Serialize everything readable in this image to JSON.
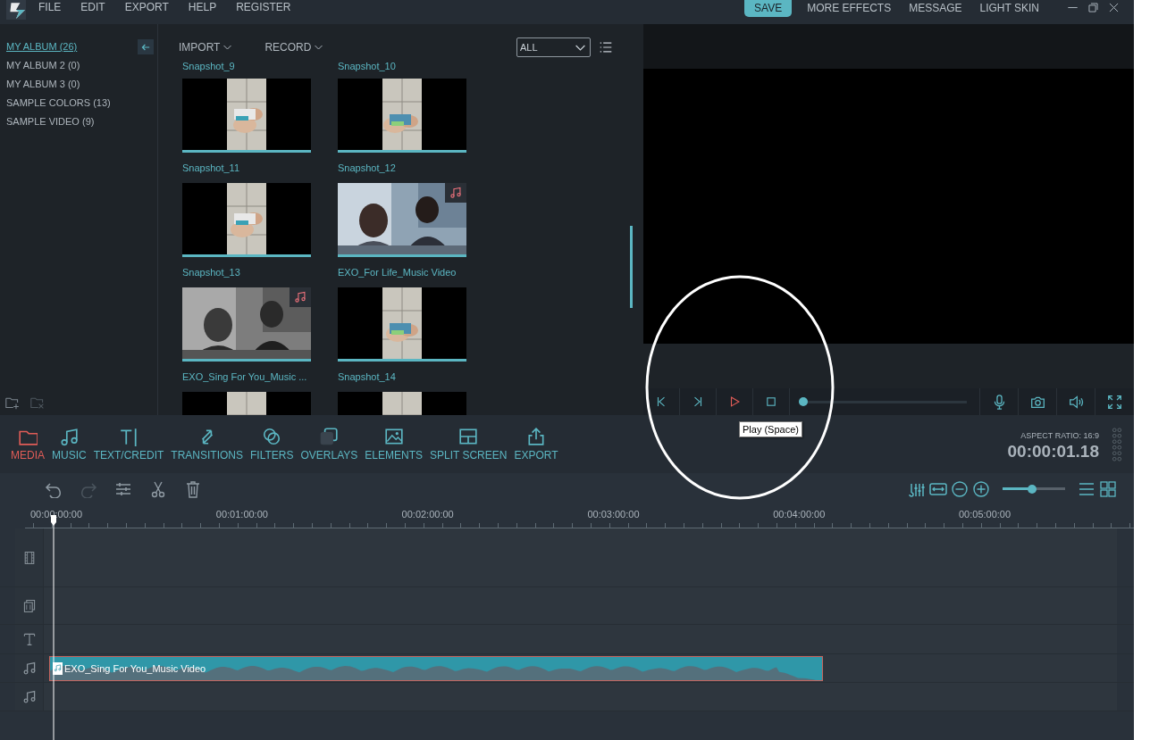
{
  "menu": [
    "FILE",
    "EDIT",
    "EXPORT",
    "HELP",
    "REGISTER"
  ],
  "top_actions": [
    {
      "label": "SAVE",
      "kind": "primary"
    },
    {
      "label": "MORE EFFECTS",
      "kind": "link"
    },
    {
      "label": "MESSAGE",
      "kind": "link"
    },
    {
      "label": "LIGHT SKIN",
      "kind": "link"
    }
  ],
  "albums": [
    {
      "label": "MY ALBUM (26)",
      "selected": true
    },
    {
      "label": "MY ALBUM 2 (0)",
      "selected": false
    },
    {
      "label": "MY ALBUM 3 (0)",
      "selected": false
    },
    {
      "label": "SAMPLE COLORS (13)",
      "selected": false
    },
    {
      "label": "SAMPLE VIDEO (9)",
      "selected": false
    }
  ],
  "media_toolbar": {
    "import": "IMPORT",
    "record": "RECORD",
    "filter": "ALL"
  },
  "media_items": [
    {
      "kind": "label_only",
      "label": "Snapshot_9"
    },
    {
      "kind": "label_only",
      "label": "Snapshot_10"
    },
    {
      "kind": "full",
      "label": "Snapshot_11",
      "music": false
    },
    {
      "kind": "full",
      "label": "Snapshot_12",
      "music": false
    },
    {
      "kind": "full",
      "label": "Snapshot_13",
      "music": false
    },
    {
      "kind": "full",
      "label": "EXO_For Life_Music Video",
      "music": true
    },
    {
      "kind": "full",
      "label": "EXO_Sing For You_Music ...",
      "music": true
    },
    {
      "kind": "full",
      "label": "Snapshot_14",
      "music": false
    },
    {
      "kind": "thumb_only",
      "music": false
    },
    {
      "kind": "thumb_only",
      "music": false
    }
  ],
  "preview": {
    "controls": [
      {
        "kind": "prev",
        "hovered": false
      },
      {
        "kind": "next",
        "hovered": false
      },
      {
        "kind": "play",
        "hovered": true
      },
      {
        "kind": "stop",
        "hovered": false
      }
    ],
    "progress": {
      "level": 0
    },
    "tooltip": "Play (Space)",
    "tools": [
      {
        "kind": "mic"
      },
      {
        "kind": "camera"
      },
      {
        "kind": "volume"
      },
      {
        "kind": "fullscreen"
      }
    ]
  },
  "tabs": [
    {
      "label": "MEDIA",
      "selected": true
    },
    {
      "label": "MUSIC",
      "selected": false
    },
    {
      "label": "TEXT/CREDIT",
      "selected": false
    },
    {
      "label": "TRANSITIONS",
      "selected": false
    },
    {
      "label": "FILTERS",
      "selected": false
    },
    {
      "label": "OVERLAYS",
      "selected": false
    },
    {
      "label": "ELEMENTS",
      "selected": false
    },
    {
      "label": "SPLIT SCREEN",
      "selected": false
    },
    {
      "label": "EXPORT",
      "selected": false
    }
  ],
  "aspect_ratio": "ASPECT RATIO: 16:9",
  "timecode": "00:00:01.18",
  "timeline": {
    "tools": [
      {
        "kind": "undo",
        "disabled": false
      },
      {
        "kind": "redo",
        "disabled": true
      },
      {
        "kind": "adjust",
        "disabled": false
      },
      {
        "kind": "cut",
        "disabled": false
      },
      {
        "kind": "delete",
        "disabled": false
      }
    ],
    "zoom": {
      "level": 0.46
    },
    "ruler": [
      "00:00:00:00",
      "00:01:00:00",
      "00:02:00:00",
      "00:03:00:00",
      "00:04:00:00",
      "00:05:00:00"
    ],
    "tracks": [
      {
        "kind": "video"
      },
      {
        "kind": "overlay"
      },
      {
        "kind": "text"
      },
      {
        "kind": "audio",
        "clips": [
          {
            "label": "EXO_Sing For You_Music Video",
            "selected": true
          }
        ]
      },
      {
        "kind": "audio"
      }
    ]
  }
}
